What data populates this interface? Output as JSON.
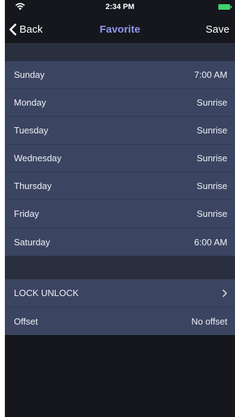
{
  "status_bar": {
    "time": "2:34 PM",
    "wifi_icon": "wifi-icon",
    "battery_icon": "battery-icon",
    "battery_color": "#3fd26a"
  },
  "nav": {
    "back_label": "Back",
    "title": "Favorite",
    "save_label": "Save",
    "title_color": "#8f97ec"
  },
  "schedule": [
    {
      "day": "Sunday",
      "value": "7:00 AM"
    },
    {
      "day": "Monday",
      "value": "Sunrise"
    },
    {
      "day": "Tuesday",
      "value": "Sunrise"
    },
    {
      "day": "Wednesday",
      "value": "Sunrise"
    },
    {
      "day": "Thursday",
      "value": "Sunrise"
    },
    {
      "day": "Friday",
      "value": "Sunrise"
    },
    {
      "day": "Saturday",
      "value": "6:00 AM"
    }
  ],
  "settings": {
    "lock_unlock_label": "LOCK UNLOCK",
    "offset_label": "Offset",
    "offset_value": "No offset"
  },
  "colors": {
    "background": "#15171d",
    "row_background": "#3b4561",
    "section_band": "#2a2f3f"
  }
}
